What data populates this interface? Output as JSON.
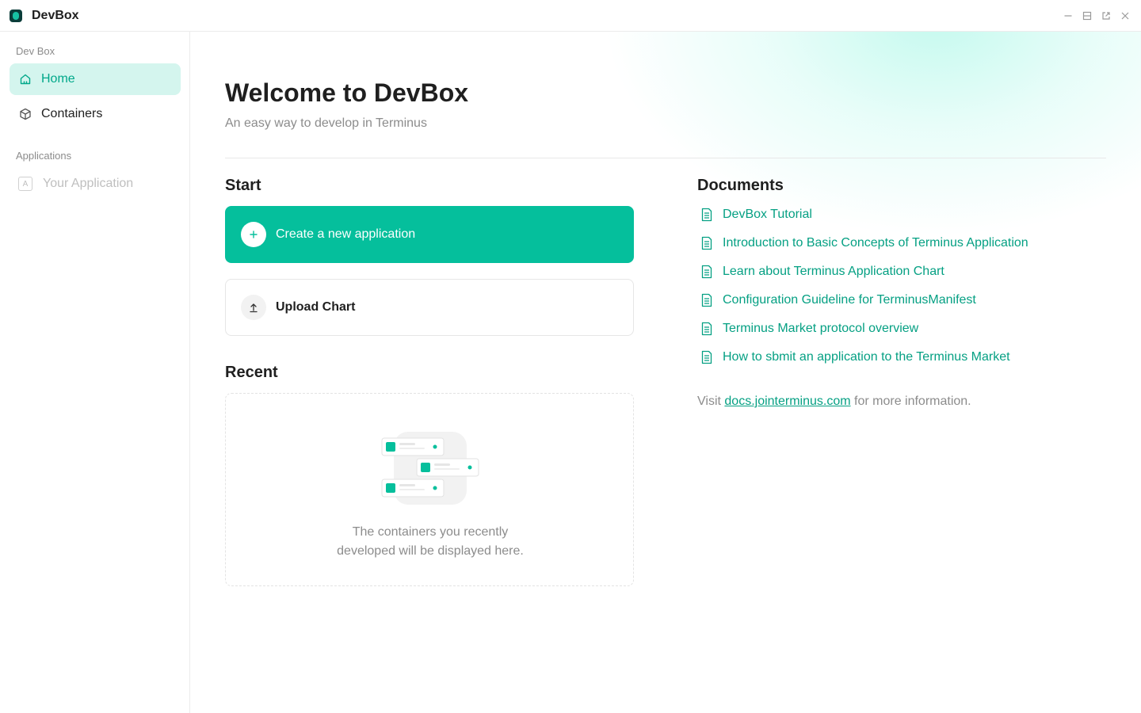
{
  "window": {
    "title": "DevBox"
  },
  "sidebar": {
    "group_devbox": "Dev Box",
    "items": [
      {
        "label": "Home",
        "icon": "home-icon",
        "active": true
      },
      {
        "label": "Containers",
        "icon": "box-icon",
        "active": false
      }
    ],
    "group_applications": "Applications",
    "app_placeholder": {
      "label": "Your Application",
      "badge": "A"
    }
  },
  "main": {
    "title": "Welcome to DevBox",
    "subtitle": "An easy way to develop in Terminus",
    "start": {
      "heading": "Start",
      "create_label": "Create a new application",
      "upload_label": "Upload Chart"
    },
    "recent": {
      "heading": "Recent",
      "empty_line1": "The containers you recently",
      "empty_line2": "developed will be displayed here."
    },
    "documents": {
      "heading": "Documents",
      "items": [
        "DevBox Tutorial",
        "Introduction to Basic Concepts of Terminus Application",
        "Learn about Terminus Application Chart",
        "Configuration Guideline for TerminusManifest",
        "Terminus Market protocol overview",
        "How to sbmit an application to the Terminus Market"
      ],
      "visit_prefix": "Visit",
      "visit_link": "docs.jointerminus.com",
      "visit_suffix": "for more information."
    }
  },
  "colors": {
    "accent": "#05bf9c",
    "accent_text": "#05a083",
    "active_bg": "#d4f5ee"
  }
}
